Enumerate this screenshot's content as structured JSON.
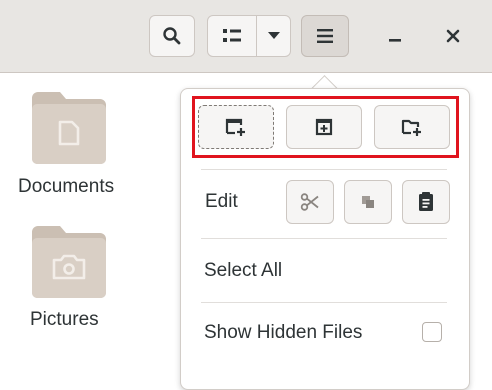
{
  "headerbar": {
    "search_icon": "search-icon",
    "view_icon": "list-view-icon",
    "view_dropdown_icon": "chevron-down-icon",
    "menu_icon": "hamburger-menu-icon",
    "minimize_icon": "minimize-icon",
    "close_icon": "close-icon"
  },
  "files": [
    {
      "label": "Documents",
      "icon": "documents-folder-icon"
    },
    {
      "label": "Pictures",
      "icon": "pictures-folder-icon"
    }
  ],
  "menu": {
    "top_buttons": [
      {
        "icon": "new-window-icon"
      },
      {
        "icon": "new-tab-icon"
      },
      {
        "icon": "new-folder-icon"
      }
    ],
    "edit_label": "Edit",
    "edit_buttons": [
      {
        "icon": "cut-icon"
      },
      {
        "icon": "copy-icon"
      },
      {
        "icon": "paste-icon"
      }
    ],
    "select_all": "Select All",
    "show_hidden": "Show Hidden Files",
    "show_hidden_checked": false
  },
  "colors": {
    "highlight": "#e0141e",
    "folder": "#d9cfc5",
    "folder_tab": "#cbbfb3"
  }
}
